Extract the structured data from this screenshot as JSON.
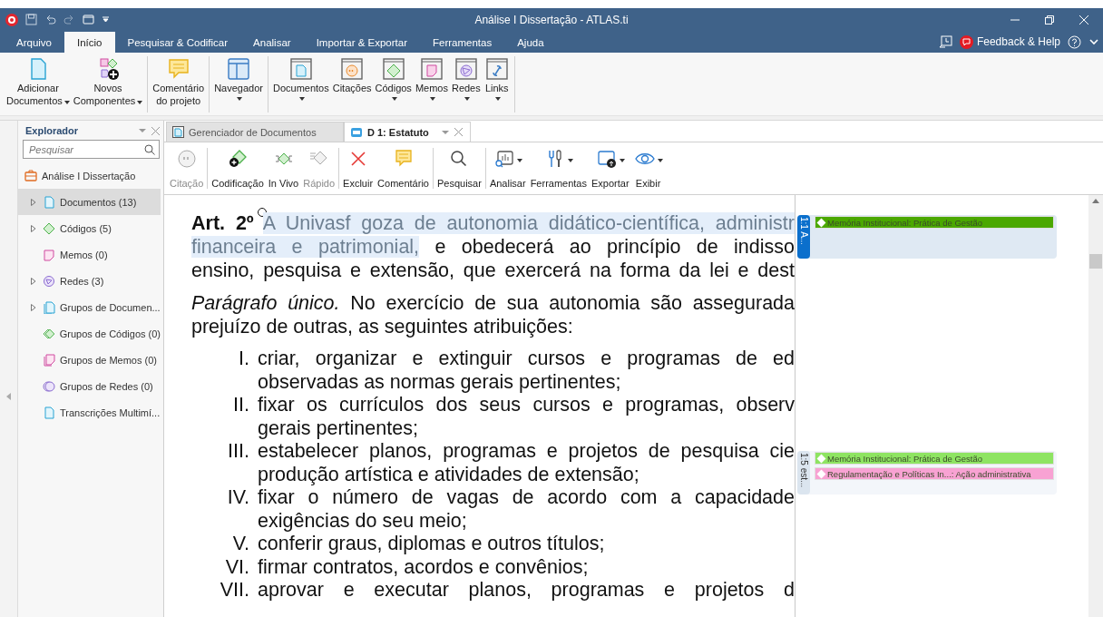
{
  "window": {
    "title": "Análise I Dissertação - ATLAS.ti"
  },
  "menu_tabs": [
    {
      "label": "Arquivo",
      "selected": false
    },
    {
      "label": "Início",
      "selected": true
    },
    {
      "label": "Pesquisar & Codificar",
      "selected": false
    },
    {
      "label": "Analisar",
      "selected": false
    },
    {
      "label": "Importar & Exportar",
      "selected": false
    },
    {
      "label": "Ferramentas",
      "selected": false
    },
    {
      "label": "Ajuda",
      "selected": false
    }
  ],
  "help": {
    "label": "Feedback & Help"
  },
  "ribbon_groups": [
    [
      {
        "lines": [
          "Adicionar",
          "Documentos"
        ],
        "dropdown": true
      },
      {
        "lines": [
          "Novos",
          "Componentes"
        ],
        "dropdown": true
      }
    ],
    [
      {
        "lines": [
          "Comentário",
          "do projeto"
        ],
        "dropdown": false
      }
    ],
    [
      {
        "lines": [
          "Navegador"
        ],
        "dropdown": true
      }
    ],
    [
      {
        "lines": [
          "Documentos"
        ],
        "dropdown": true
      },
      {
        "lines": [
          "Citações"
        ],
        "dropdown": false
      },
      {
        "lines": [
          "Códigos"
        ],
        "dropdown": true
      },
      {
        "lines": [
          "Memos"
        ],
        "dropdown": true
      },
      {
        "lines": [
          "Redes"
        ],
        "dropdown": true
      },
      {
        "lines": [
          "Links"
        ],
        "dropdown": true
      }
    ]
  ],
  "explorer": {
    "title": "Explorador",
    "search": {
      "placeholder": "Pesquisar"
    },
    "project": "Análise I Dissertação",
    "items": [
      {
        "label": "Documentos (13)",
        "expandable": true,
        "selected": true
      },
      {
        "label": "Códigos (5)",
        "expandable": true,
        "selected": false
      },
      {
        "label": "Memos (0)",
        "expandable": false,
        "selected": false
      },
      {
        "label": "Redes (3)",
        "expandable": true,
        "selected": false
      },
      {
        "label": "Grupos de Documen...",
        "expandable": true,
        "selected": false
      },
      {
        "label": "Grupos de Códigos (0)",
        "expandable": false,
        "selected": false
      },
      {
        "label": "Grupos de Memos (0)",
        "expandable": false,
        "selected": false
      },
      {
        "label": "Grupos de Redes (0)",
        "expandable": false,
        "selected": false
      },
      {
        "label": "Transcrições Multimí...",
        "expandable": false,
        "selected": false
      }
    ]
  },
  "doc_tabs": [
    {
      "label": "Gerenciador de Documentos",
      "selected": false
    },
    {
      "label": "D 1: Estatuto",
      "selected": true
    }
  ],
  "doc_toolbar": [
    [
      {
        "label": "Citação",
        "disabled": true,
        "dropdown": false
      }
    ],
    [
      {
        "label": "Codificação",
        "disabled": false,
        "dropdown": false
      },
      {
        "label": "In Vivo",
        "disabled": false,
        "dropdown": false
      },
      {
        "label": "Rápido",
        "disabled": true,
        "dropdown": false
      }
    ],
    [
      {
        "label": "Excluir",
        "disabled": false,
        "dropdown": false
      },
      {
        "label": "Comentário",
        "disabled": false,
        "dropdown": false
      }
    ],
    [
      {
        "label": "Pesquisar",
        "disabled": false,
        "dropdown": false
      }
    ],
    [
      {
        "label": "Analisar",
        "disabled": false,
        "dropdown": true
      },
      {
        "label": "Ferramentas",
        "disabled": false,
        "dropdown": true
      },
      {
        "label": "Exportar",
        "disabled": false,
        "dropdown": true
      },
      {
        "label": "Exibir",
        "disabled": false,
        "dropdown": true
      }
    ]
  ],
  "document": {
    "paragraphs": [
      {
        "kind": "text",
        "lines": [
          {
            "wrapped": true,
            "segments": [
              {
                "kind": "heading",
                "text": "Art. 2º"
              },
              {
                "kind": "quoted",
                "text": "A Univasf goza de autonomia didático-científica, administr"
              }
            ]
          },
          {
            "wrapped": true,
            "segments": [
              {
                "kind": "quoted",
                "text": "financeira e patrimonial,"
              },
              {
                "kind": "plain",
                "text": " e obedecerá ao princípio de indisso"
              }
            ]
          },
          {
            "wrapped": true,
            "segments": [
              {
                "kind": "plain",
                "text": "ensino, pesquisa e extensão, que exercerá na forma da lei e dest"
              }
            ]
          }
        ]
      },
      {
        "kind": "text",
        "lines": [
          {
            "wrapped": true,
            "segments": [
              {
                "kind": "emphasis",
                "text": "Parágrafo único."
              },
              {
                "kind": "plain",
                "text": " No exercício de sua autonomia são assegurada"
              }
            ]
          },
          {
            "wrapped": false,
            "segments": [
              {
                "kind": "plain",
                "text": "prejuízo de outras, as seguintes atribuições:"
              }
            ]
          }
        ]
      },
      {
        "kind": "item",
        "numeral": "I.",
        "lines": [
          {
            "wrapped": true,
            "segments": [
              {
                "kind": "plain",
                "text": "criar, organizar e extinguir cursos e programas de ed"
              }
            ]
          },
          {
            "wrapped": false,
            "segments": [
              {
                "kind": "plain",
                "text": "observadas as normas gerais pertinentes;"
              }
            ]
          }
        ]
      },
      {
        "kind": "item",
        "numeral": "II.",
        "lines": [
          {
            "wrapped": true,
            "segments": [
              {
                "kind": "plain",
                "text": "fixar os currículos dos seus cursos e programas, observ"
              }
            ]
          },
          {
            "wrapped": false,
            "segments": [
              {
                "kind": "plain",
                "text": "gerais pertinentes;"
              }
            ]
          }
        ]
      },
      {
        "kind": "item",
        "numeral": "III.",
        "lines": [
          {
            "wrapped": true,
            "segments": [
              {
                "kind": "plain",
                "text": "estabelecer planos, programas e projetos de pesquisa cie"
              }
            ]
          },
          {
            "wrapped": false,
            "segments": [
              {
                "kind": "plain",
                "text": "produção artística e atividades de extensão;"
              }
            ]
          }
        ]
      },
      {
        "kind": "item",
        "numeral": "IV.",
        "lines": [
          {
            "wrapped": true,
            "segments": [
              {
                "kind": "plain",
                "text": "fixar o número de vagas de acordo com a capacidade"
              }
            ]
          },
          {
            "wrapped": false,
            "segments": [
              {
                "kind": "plain",
                "text": "exigências do seu meio;"
              }
            ]
          }
        ]
      },
      {
        "kind": "item",
        "numeral": "V.",
        "lines": [
          {
            "wrapped": false,
            "segments": [
              {
                "kind": "plain",
                "text": "conferir graus, diplomas e outros títulos;"
              }
            ]
          }
        ]
      },
      {
        "kind": "item",
        "numeral": "VI.",
        "lines": [
          {
            "wrapped": false,
            "segments": [
              {
                "kind": "plain",
                "text": "firmar contratos, acordos e convênios;"
              }
            ]
          }
        ]
      },
      {
        "kind": "item",
        "numeral": "VII.",
        "lines": [
          {
            "wrapped": true,
            "segments": [
              {
                "kind": "plain",
                "text": "aprovar e executar planos, programas e projetos d"
              }
            ]
          }
        ]
      }
    ]
  },
  "quotations": [
    {
      "label": "1:1 A...",
      "selected": true,
      "codes": [
        {
          "label": "Memória Institucional: Prática de Gestão",
          "color": "#4ba800"
        }
      ]
    },
    {
      "label": "1:5 est...",
      "selected": false,
      "codes": [
        {
          "label": "Memória Institucional: Prática de Gestão",
          "color": "#8ee462"
        },
        {
          "label": "Regulamentação e Políticas In...: Ação administrativa",
          "color": "#f8a2d3"
        }
      ]
    }
  ]
}
